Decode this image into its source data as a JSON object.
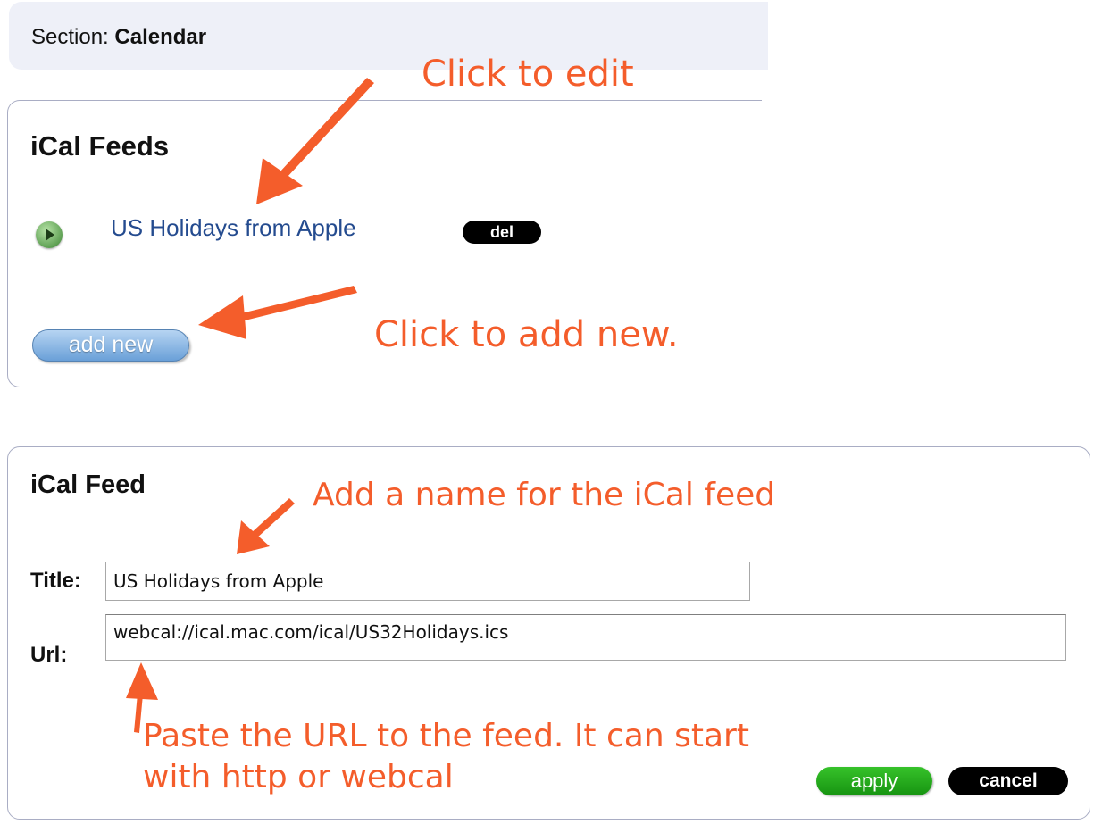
{
  "section": {
    "label": "Section:",
    "value": "Calendar"
  },
  "feeds_panel": {
    "title": "iCal Feeds",
    "items": [
      {
        "name": "US Holidays from Apple",
        "delete_label": "del"
      }
    ],
    "add_new_label": "add new"
  },
  "form": {
    "title": "iCal Feed",
    "title_label": "Title:",
    "title_value": "US Holidays from Apple",
    "url_label": "Url:",
    "url_value": "webcal://ical.mac.com/ical/US32Holidays.ics",
    "apply_label": "apply",
    "cancel_label": "cancel"
  },
  "annotations": {
    "edit": "Click to edit",
    "add_new": "Click to add new.",
    "name": "Add a name for the iCal feed",
    "paste_line1": "Paste the URL to the feed. It can start",
    "paste_line2": "with http or webcal"
  },
  "colors": {
    "annotation": "#f45d2b",
    "link": "#244b8f",
    "apply": "#1fa617"
  }
}
